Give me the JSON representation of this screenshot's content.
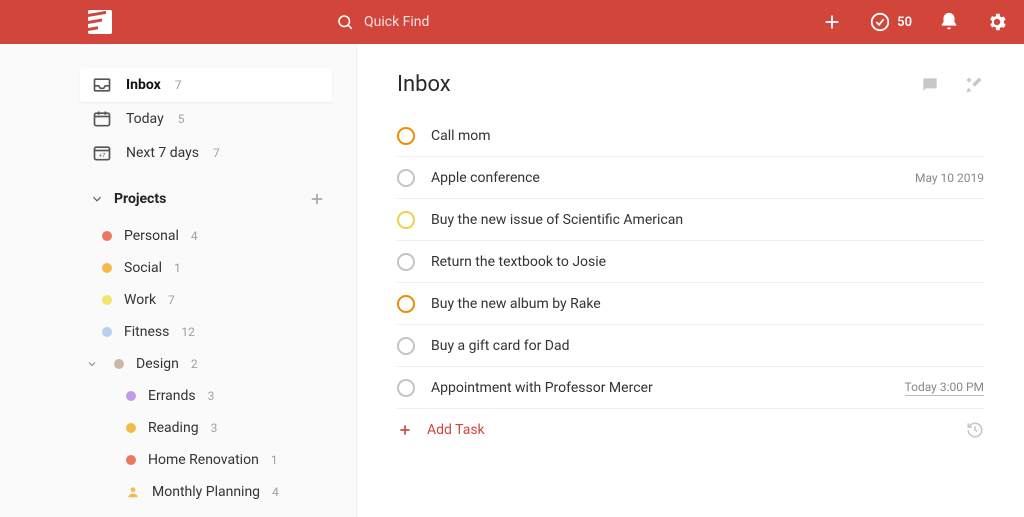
{
  "search_placeholder": "Quick Find",
  "karma": "50",
  "filters": [
    {
      "label": "Inbox",
      "count": "7"
    },
    {
      "label": "Today",
      "count": "5"
    },
    {
      "label": "Next 7 days",
      "count": "7"
    }
  ],
  "projects_header": "Projects",
  "projects": [
    {
      "name": "Personal",
      "count": "4",
      "color": "#e9795d"
    },
    {
      "name": "Social",
      "count": "1",
      "color": "#f6b94a"
    },
    {
      "name": "Work",
      "count": "7",
      "color": "#f4e36e"
    },
    {
      "name": "Fitness",
      "count": "12",
      "color": "#b7d0ef"
    },
    {
      "name": "Design",
      "count": "2",
      "color": "#c9b8a8"
    }
  ],
  "subprojects": [
    {
      "name": "Errands",
      "count": "3",
      "color": "#c29be8"
    },
    {
      "name": "Reading",
      "count": "3",
      "color": "#f6b94a"
    },
    {
      "name": "Home Renovation",
      "count": "1",
      "color": "#e9795d"
    },
    {
      "name": "Monthly Planning",
      "count": "4",
      "color": "#f6b94a",
      "shared": true
    }
  ],
  "main_title": "Inbox",
  "tasks": [
    {
      "title": "Call mom",
      "priority": "orange"
    },
    {
      "title": "Apple conference",
      "priority": "gray",
      "date": "May 10 2019"
    },
    {
      "title": "Buy the new issue of Scientific American",
      "priority": "yellow"
    },
    {
      "title": "Return the textbook to Josie",
      "priority": "gray"
    },
    {
      "title": "Buy the new album by Rake",
      "priority": "orange"
    },
    {
      "title": "Buy a gift card for Dad",
      "priority": "gray"
    },
    {
      "title": "Appointment with Professor Mercer",
      "priority": "gray",
      "date": "Today 3:00 PM",
      "date_underline": true
    }
  ],
  "add_task_label": "Add Task"
}
